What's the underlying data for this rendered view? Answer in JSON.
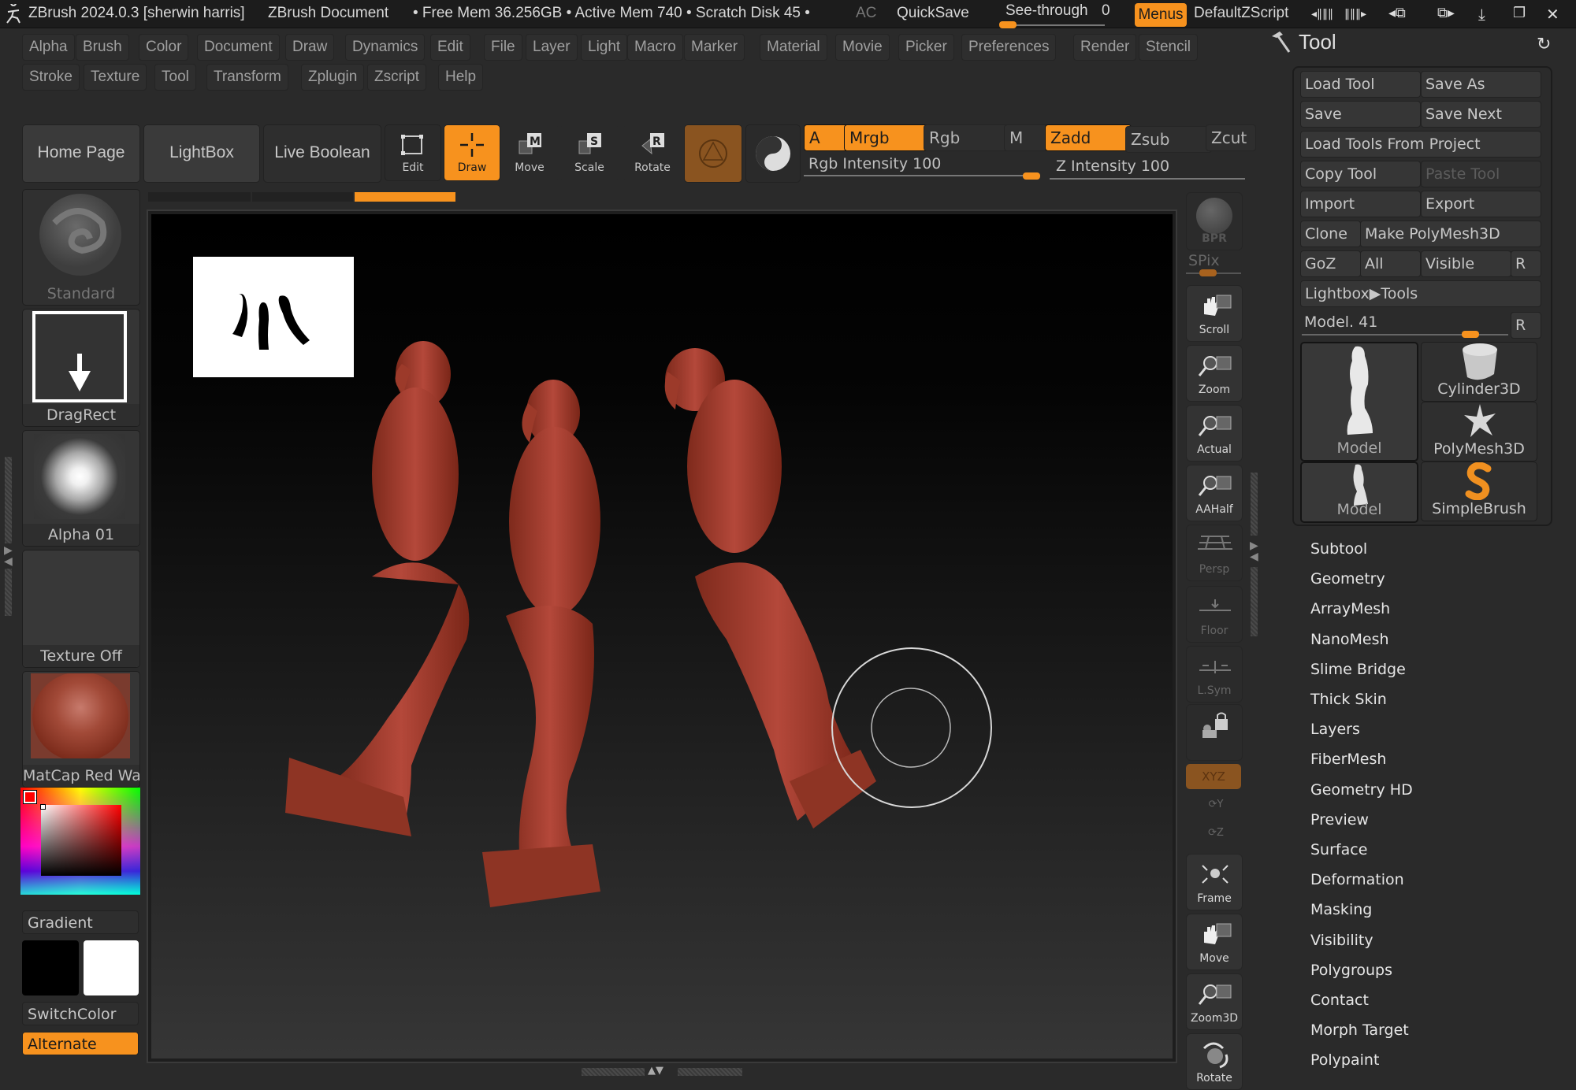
{
  "titlebar": {
    "app_title": "ZBrush 2024.0.3 [sherwin harris]",
    "document": "ZBrush Document",
    "memory": "• Free Mem 36.256GB • Active Mem 740 • Scratch Disk 45 • ",
    "ac": "AC",
    "quicksave": "QuickSave",
    "see_through_label": "See-through",
    "see_through_value": "0",
    "see_through_fraction": 0,
    "menus": "Menus",
    "default_zscript": "DefaultZScript"
  },
  "menus": {
    "row1": [
      "Alpha",
      "Brush",
      "Color",
      "Document",
      "Draw",
      "Dynamics",
      "Edit",
      "File",
      "Layer",
      "Light",
      "Macro",
      "Marker",
      "Material",
      "Movie",
      "Picker",
      "Preferences",
      "Render",
      "Stencil"
    ],
    "row2": [
      "Stroke",
      "Texture",
      "Tool",
      "Transform",
      "Zplugin",
      "Zscript",
      "Help"
    ]
  },
  "shelf": {
    "home_page": "Home Page",
    "lightbox": "LightBox",
    "live_boolean": "Live Boolean",
    "modes": [
      {
        "label": "Edit",
        "active": false
      },
      {
        "label": "Draw",
        "active": true
      },
      {
        "label": "Move",
        "active": false
      },
      {
        "label": "Scale",
        "active": false
      },
      {
        "label": "Rotate",
        "active": false
      }
    ]
  },
  "draw_options": {
    "a": "A",
    "mrgb": "Mrgb",
    "rgb": "Rgb",
    "m": "M",
    "zadd": "Zadd",
    "zsub": "Zsub",
    "zcut": "Zcut",
    "rgb_intensity_label": "Rgb Intensity",
    "rgb_intensity_value": "100",
    "z_intensity_label": "Z Intensity",
    "z_intensity_value": "100"
  },
  "left_shelf": {
    "brush": "Standard",
    "stroke": "DragRect",
    "alpha": "Alpha 01",
    "texture": "Texture Off",
    "material": "MatCap Red Wax",
    "gradient": "Gradient",
    "switch_color": "SwitchColor",
    "alternate": "Alternate",
    "main_color": "#ff0000",
    "secondary_color": "#000000",
    "primary_swatch": "#ffffff"
  },
  "right_shelf": {
    "bpr": "BPR",
    "spix": "SPix",
    "buttons": [
      "Scroll",
      "Zoom",
      "Actual",
      "AAHalf",
      "Persp",
      "Floor",
      "L.Sym",
      "",
      "XYZ",
      "Y",
      "Z",
      "Frame",
      "Move",
      "Zoom3D",
      "Rotate"
    ]
  },
  "tool_palette": {
    "title": "Tool",
    "load_tool": "Load Tool",
    "save_as": "Save As",
    "save": "Save",
    "save_next": "Save Next",
    "load_from_project": "Load Tools From Project",
    "copy_tool": "Copy Tool",
    "paste_tool": "Paste Tool",
    "import": "Import",
    "export": "Export",
    "clone": "Clone",
    "make_polymesh": "Make PolyMesh3D",
    "goz": "GoZ",
    "all": "All",
    "visible": "Visible",
    "r": "R",
    "lightbox_tools": "Lightbox▶Tools",
    "model_label": "Model. 41",
    "model_slider_fraction": 0.8,
    "thumbs": [
      "Model",
      "Cylinder3D",
      "PolyMesh3D",
      "Model",
      "SimpleBrush"
    ],
    "subpalettes": [
      "Subtool",
      "Geometry",
      "ArrayMesh",
      "NanoMesh",
      "Slime Bridge",
      "Thick Skin",
      "Layers",
      "FiberMesh",
      "Geometry HD",
      "Preview",
      "Surface",
      "Deformation",
      "Masking",
      "Visibility",
      "Polygroups",
      "Contact",
      "Morph Target",
      "Polypaint"
    ]
  },
  "colors": {
    "accent": "#f7921e",
    "model": "#a8392a",
    "panel": "#2a2a2a"
  }
}
